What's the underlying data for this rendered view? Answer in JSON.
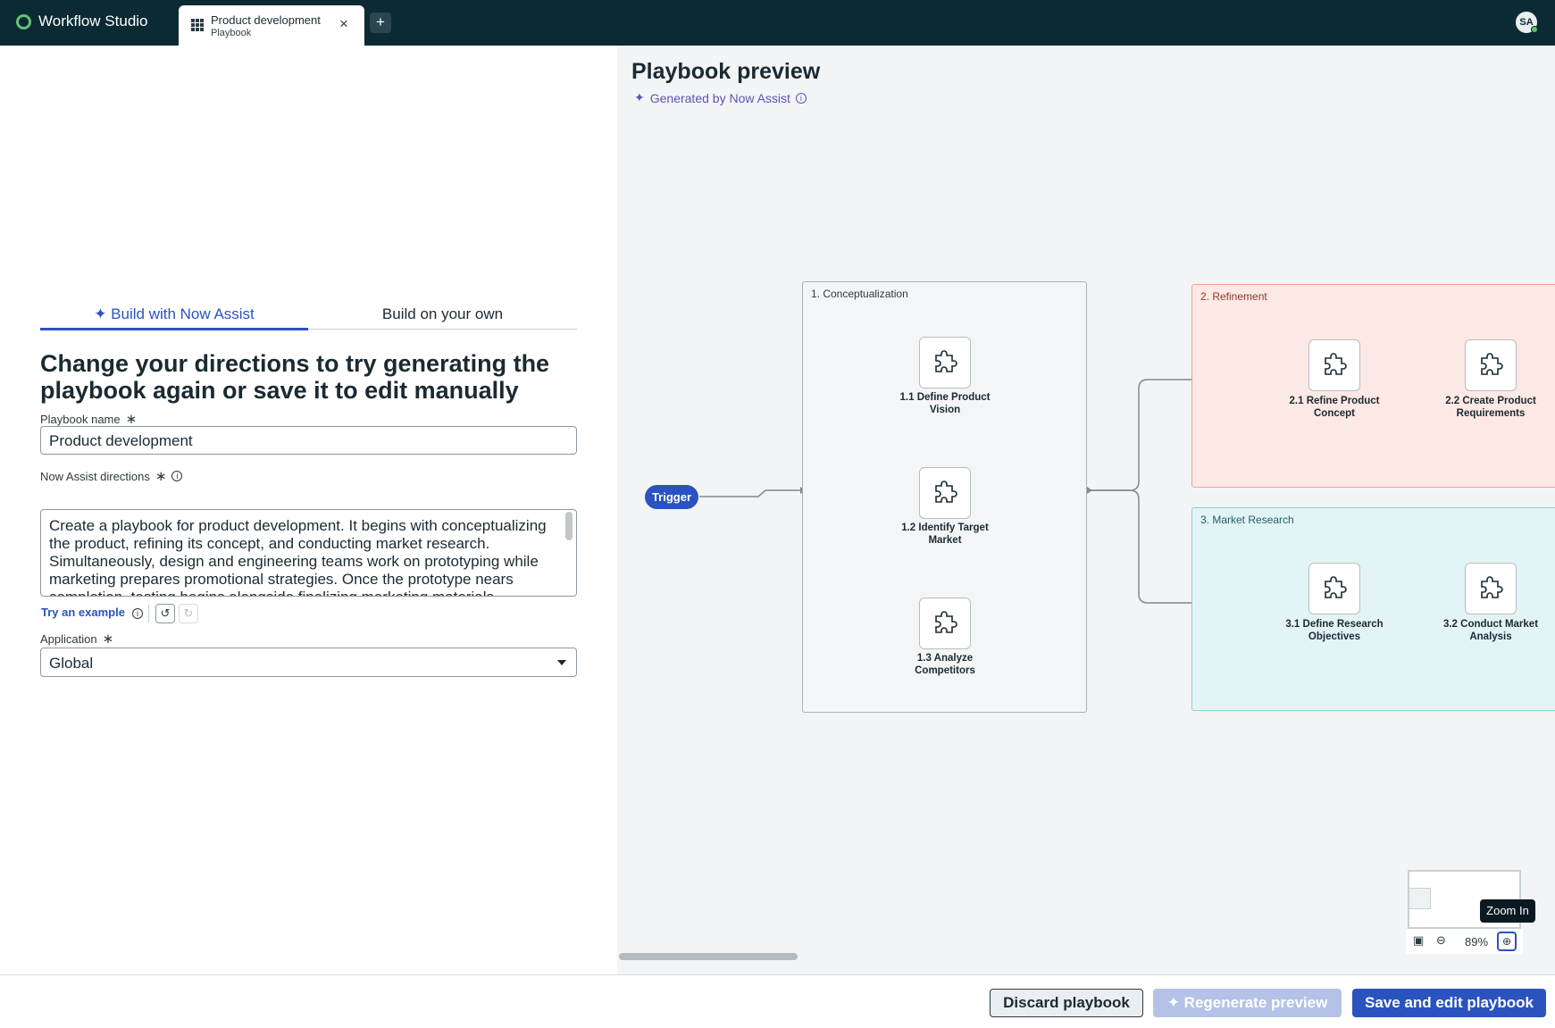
{
  "app": {
    "title": "Workflow Studio",
    "avatar_initials": "SA"
  },
  "tab": {
    "title": "Product development",
    "subtitle": "Playbook",
    "close_glyph": "×",
    "add_glyph": "+"
  },
  "form": {
    "tabs": [
      {
        "label": "Build with Now Assist"
      },
      {
        "label": "Build on your own"
      }
    ],
    "heading": "Change your directions to try generating the playbook again or save it to edit manually",
    "name_label": "Playbook name",
    "name_value": "Product development",
    "directions_label": "Now Assist directions",
    "directions_value": "Create a playbook for product development. It begins with conceptualizing the product, refining its concept, and conducting market research. Simultaneously, design and engineering teams work on prototyping while marketing prepares promotional strategies. Once the prototype nears completion, testing begins alongside finalizing marketing materials.",
    "try_example": "Try an example",
    "application_label": "Application",
    "application_value": "Global",
    "required_glyph": "∗"
  },
  "preview": {
    "title": "Playbook preview",
    "generated": "Generated by Now Assist",
    "trigger": "Trigger",
    "lanes": [
      {
        "label": "1. Conceptualization",
        "color": "#a9b1b5",
        "steps": [
          "1.1 Define Product Vision",
          "1.2 Identify Target Market",
          "1.3 Analyze Competitors"
        ]
      },
      {
        "label": "2. Refinement",
        "color": "#f1a395",
        "steps": [
          "2.1 Refine Product Concept",
          "2.2 Create Product Requirements"
        ]
      },
      {
        "label": "3. Market Research",
        "color": "#8fd0d9",
        "steps": [
          "3.1 Define Research Objectives",
          "3.2 Conduct Market Analysis"
        ]
      }
    ],
    "zoom_level": "89%",
    "tooltip": "Zoom In"
  },
  "footer": {
    "discard": "Discard playbook",
    "regenerate": "Regenerate preview",
    "save": "Save and edit playbook"
  },
  "colors": {
    "accent": "#2a53c0",
    "topbar": "#0b2a33",
    "assist": "#5a55b8"
  }
}
